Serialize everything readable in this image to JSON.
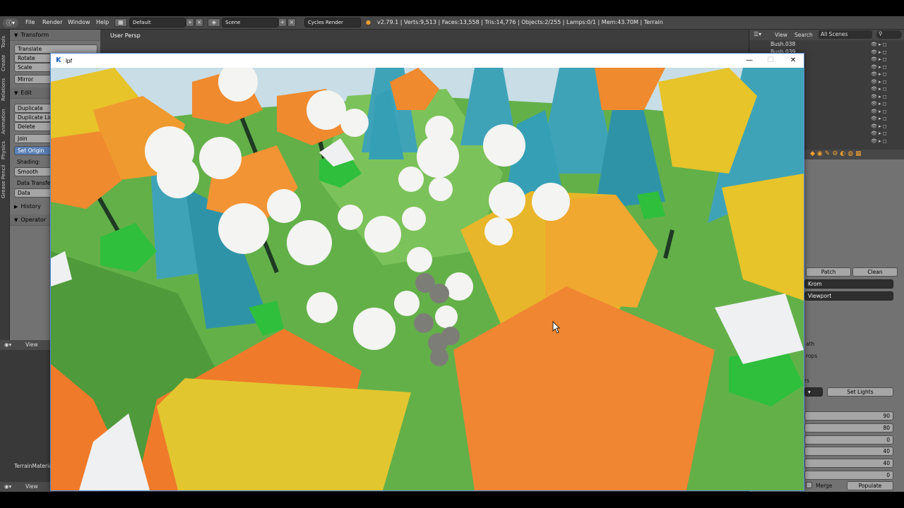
{
  "blender_header": {
    "menus": [
      "File",
      "Render",
      "Window",
      "Help"
    ],
    "layout": "Default",
    "scene": "Scene",
    "engine": "Cycles Render",
    "stats": "v2.79.1 | Verts:9,513 | Faces:13,558 | Tris:14,776 | Objects:2/255 | Lamps:0/1 | Mem:43.70M | Terrain"
  },
  "left_tabs": [
    "Tools",
    "Create",
    "Relations",
    "Animation",
    "Physics",
    "Grease Pencil"
  ],
  "tool_shelf": {
    "transform_title": "Transform",
    "transform_buttons": [
      "Translate",
      "Rotate",
      "Scale",
      "Mirror"
    ],
    "edit_title": "Edit",
    "edit_buttons": [
      "Duplicate",
      "Duplicate Link",
      "Delete",
      "Join",
      "Set Origin"
    ],
    "shading_label": "Shading:",
    "shading_value": "Smooth",
    "data_transfer_label": "Data Transfer:",
    "data_transfer_value": "Data",
    "history_title": "History",
    "operator_title": "Operator"
  },
  "left_lower": {
    "view_label": "View",
    "terrain_material": "TerrainMaterial",
    "bottom_view_label": "View"
  },
  "viewport": {
    "label": "User Persp"
  },
  "outliner": {
    "view_label": "View",
    "search_label": "Search",
    "scenes_value": "All Scenes",
    "items": [
      "Bush.038",
      "Bush.039"
    ]
  },
  "properties": {
    "patch_button": "Patch",
    "clean_button": "Clean",
    "renderer_value": "Krom",
    "viewport_value": "Viewport",
    "path_label": "ath",
    "props_label": "rops",
    "rs_label": "rs",
    "set_lights_button": "Set Lights",
    "number_fields": [
      "90",
      "80",
      "0",
      "40",
      "40",
      "0"
    ],
    "merge_label": "Merge",
    "populate_button": "Populate"
  },
  "game_window": {
    "title": "lpf",
    "logo_letter": "K",
    "controls": [
      "—",
      "☐",
      "✕"
    ]
  },
  "colors": {
    "blender_header": "#474747",
    "panel_bg": "#727272",
    "active_button": "#5a7fb5",
    "window_border": "#5b8fd6",
    "sky": "#c8dde6",
    "grass": "#63b049",
    "tree_teal": "#3fa3b8",
    "rock_orange": "#ef8a2e",
    "rock_yellow": "#e6c42a"
  }
}
